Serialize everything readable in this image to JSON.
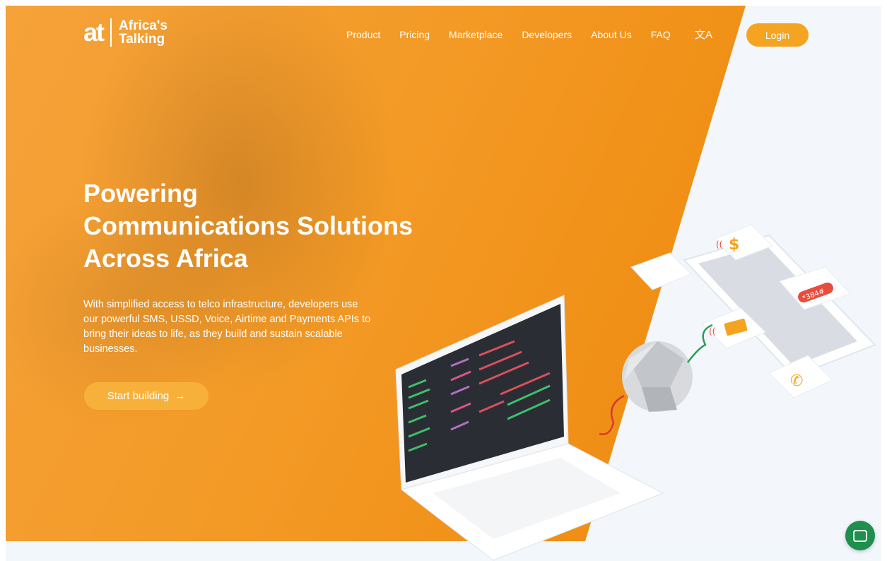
{
  "brand": {
    "mark": "at",
    "name_line1": "Africa's",
    "name_line2": "Talking"
  },
  "nav": {
    "items": [
      "Product",
      "Pricing",
      "Marketplace",
      "Developers",
      "About Us",
      "FAQ"
    ],
    "translate_icon": "translate-icon",
    "login_label": "Login"
  },
  "hero": {
    "headline_line1": "Powering",
    "headline_line2": "Communications Solutions",
    "headline_line3": "Across Africa",
    "subtext": "With simplified access to telco infrastructure, developers use our powerful SMS, USSD, Voice, Airtime and Payments APIs to bring their ideas to life, as they build and sustain scalable businesses.",
    "cta_label": "Start building",
    "cta_icon": "arrow-right-icon"
  },
  "illustration": {
    "ussd_badge": "*384#"
  },
  "colors": {
    "primary_orange": "#f39a26",
    "accent_light_orange": "#f7b13a",
    "chat_green": "#1f8f4e",
    "right_bg": "#f3f7fb"
  },
  "chat_widget": {
    "icon": "chat-icon"
  }
}
